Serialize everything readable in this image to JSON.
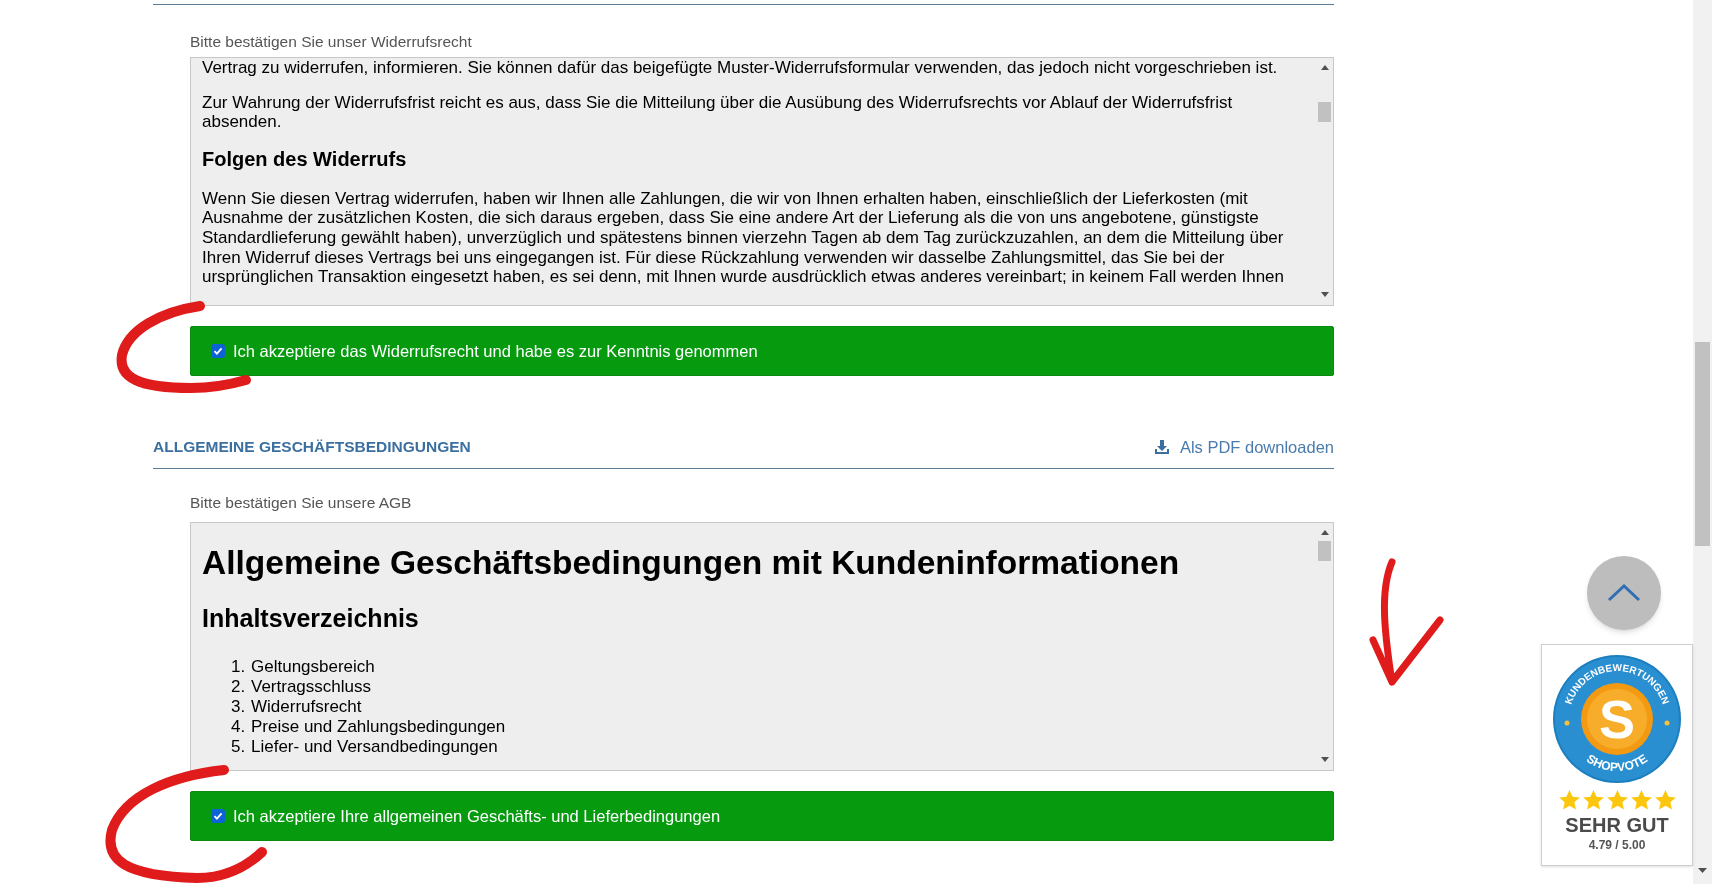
{
  "withdrawal": {
    "prompt": "Bitte bestätigen Sie unser Widerrufsrecht",
    "document": [
      {
        "kind": "paragraph",
        "text": "Vertrag zu widerrufen, informieren. Sie können dafür das beigefügte Muster-Widerrufsformular verwenden, das jedoch nicht vorgeschrieben ist."
      },
      {
        "kind": "paragraph",
        "text": "Zur Wahrung der Widerrufsfrist reicht es aus, dass Sie die Mitteilung über die Ausübung des Widerrufsrechts vor Ablauf der Widerrufsfrist absenden."
      },
      {
        "kind": "heading",
        "text": "Folgen des Widerrufs"
      },
      {
        "kind": "paragraph",
        "text": "Wenn Sie diesen Vertrag widerrufen, haben wir Ihnen alle Zahlungen, die wir von Ihnen erhalten haben, einschließlich der Lieferkosten (mit Ausnahme der zusätzlichen Kosten, die sich daraus ergeben, dass Sie eine andere Art der Lieferung als die von uns angebotene, günstigste Standardlieferung gewählt haben), unverzüglich und spätestens binnen vierzehn Tagen ab dem Tag zurückzuzahlen, an dem die Mitteilung über Ihren Widerruf dieses Vertrags bei uns eingegangen ist. Für diese Rückzahlung verwenden wir dasselbe Zahlungsmittel, das Sie bei der ursprünglichen Transaktion eingesetzt haben, es sei denn, mit Ihnen wurde ausdrücklich etwas anderes vereinbart; in keinem Fall werden Ihnen"
      }
    ],
    "consent": {
      "label": "Ich akzeptiere das Widerrufsrecht und habe es zur Kenntnis genommen",
      "checked": true
    }
  },
  "terms": {
    "title": "ALLGEMEINE GESCHÄFTSBEDINGUNGEN",
    "download_link": "Als PDF downloaden",
    "prompt": "Bitte bestätigen Sie unsere AGB",
    "document": [
      {
        "kind": "title",
        "text": "Allgemeine Geschäftsbedingungen mit Kundeninformationen"
      },
      {
        "kind": "heading",
        "text": "Inhaltsverzeichnis"
      },
      {
        "kind": "list",
        "items": [
          {
            "number": "1.",
            "text": "Geltungsbereich"
          },
          {
            "number": "2.",
            "text": "Vertragsschluss"
          },
          {
            "number": "3.",
            "text": "Widerrufsrecht"
          },
          {
            "number": "4.",
            "text": "Preise und Zahlungsbedingungen"
          },
          {
            "number": "5.",
            "text": "Liefer- und Versandbedingungen"
          }
        ]
      }
    ],
    "consent": {
      "label": "Ich akzeptiere Ihre allgemeinen Geschäfts- und Lieferbedingungen",
      "checked": true
    }
  },
  "rating_badge": {
    "arc_top": "KUNDENBEWERTUNGEN",
    "logo_letter": "S",
    "arc_bottom": "SHOPVOTE",
    "stars": 5,
    "verdict": "SEHR GUT",
    "score": "4.79 / 5.00"
  }
}
